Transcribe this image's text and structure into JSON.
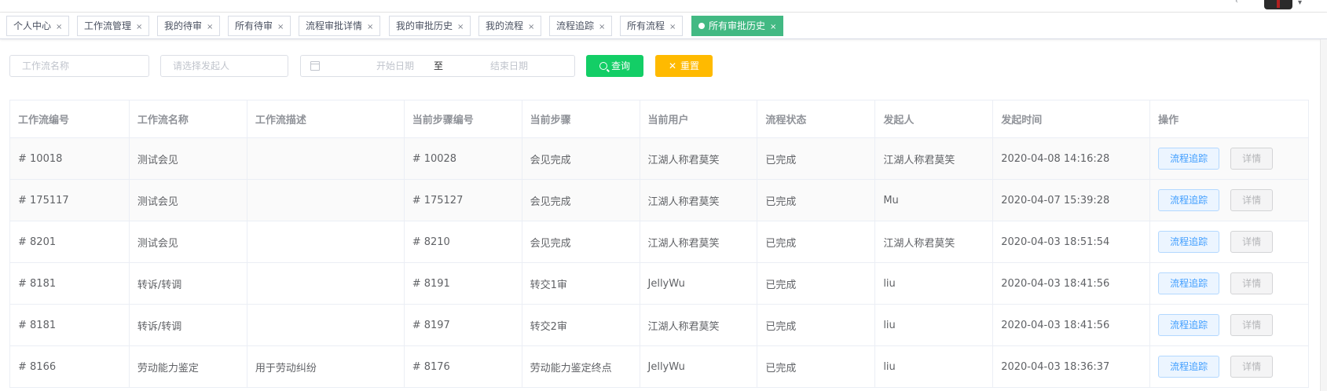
{
  "header": {
    "avatar_label": "user-avatar"
  },
  "tags": [
    {
      "label": "个人中心",
      "close": "×",
      "active": false
    },
    {
      "label": "工作流管理",
      "close": "×",
      "active": false
    },
    {
      "label": "我的待审",
      "close": "×",
      "active": false
    },
    {
      "label": "所有待审",
      "close": "×",
      "active": false
    },
    {
      "label": "流程审批详情",
      "close": "×",
      "active": false
    },
    {
      "label": "我的审批历史",
      "close": "×",
      "active": false
    },
    {
      "label": "我的流程",
      "close": "×",
      "active": false
    },
    {
      "label": "流程追踪",
      "close": "×",
      "active": false
    },
    {
      "label": "所有流程",
      "close": "×",
      "active": false
    },
    {
      "label": "所有审批历史",
      "close": "×",
      "active": true
    }
  ],
  "filters": {
    "workflow_name_placeholder": "工作流名称",
    "initiator_placeholder": "请选择发起人",
    "start_date_placeholder": "开始日期",
    "range_separator": "至",
    "end_date_placeholder": "结束日期",
    "search_label": "查询",
    "reset_label": "重置"
  },
  "colors": {
    "active_tag": "#42b983",
    "search_button": "#13ce66",
    "reset_button": "#ffba00",
    "track_button_text": "#409eff"
  },
  "table": {
    "columns": [
      "工作流编号",
      "工作流名称",
      "工作流描述",
      "当前步骤编号",
      "当前步骤",
      "当前用户",
      "流程状态",
      "发起人",
      "发起时间",
      "操作"
    ],
    "rows": [
      {
        "id": "# 10018",
        "name": "测试会见",
        "desc": "",
        "step_id": "# 10028",
        "step": "会见完成",
        "user": "江湖人称君莫笑",
        "status": "已完成",
        "initiator": "江湖人称君莫笑",
        "time": "2020-04-08 14:16:28"
      },
      {
        "id": "# 175117",
        "name": "测试会见",
        "desc": "",
        "step_id": "# 175127",
        "step": "会见完成",
        "user": "江湖人称君莫笑",
        "status": "已完成",
        "initiator": "Mu",
        "time": "2020-04-07 15:39:28"
      },
      {
        "id": "# 8201",
        "name": "测试会见",
        "desc": "",
        "step_id": "# 8210",
        "step": "会见完成",
        "user": "江湖人称君莫笑",
        "status": "已完成",
        "initiator": "江湖人称君莫笑",
        "time": "2020-04-03 18:51:54"
      },
      {
        "id": "# 8181",
        "name": "转诉/转调",
        "desc": "",
        "step_id": "# 8191",
        "step": "转交1审",
        "user": "JellyWu",
        "status": "已完成",
        "initiator": "liu",
        "time": "2020-04-03 18:41:56"
      },
      {
        "id": "# 8181",
        "name": "转诉/转调",
        "desc": "",
        "step_id": "# 8197",
        "step": "转交2审",
        "user": "江湖人称君莫笑",
        "status": "已完成",
        "initiator": "liu",
        "time": "2020-04-03 18:41:56"
      },
      {
        "id": "# 8166",
        "name": "劳动能力鉴定",
        "desc": "用于劳动纠纷",
        "step_id": "# 8176",
        "step": "劳动能力鉴定终点",
        "user": "JellyWu",
        "status": "已完成",
        "initiator": "liu",
        "time": "2020-04-03 18:36:37"
      }
    ],
    "actions": {
      "track": "流程追踪",
      "detail": "详情"
    }
  }
}
